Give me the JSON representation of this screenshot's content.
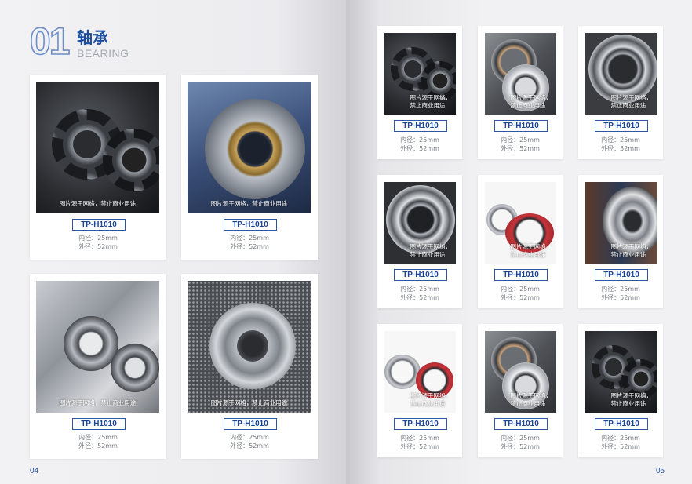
{
  "left_page": {
    "section_number": "01",
    "section_title": "轴承",
    "section_subtitle": "BEARING",
    "page_number": "04"
  },
  "right_page": {
    "page_number": "05"
  },
  "watermark_text": "图片源于网络，禁止商业用途",
  "watermark_line1": "图片源于网络，",
  "watermark_line2": "禁止商业用途",
  "products_left": [
    {
      "model": "TP-H1010",
      "inner": "内径：25mm",
      "outer": "外径：52mm"
    },
    {
      "model": "TP-H1010",
      "inner": "内径：25mm",
      "outer": "外径：52mm"
    },
    {
      "model": "TP-H1010",
      "inner": "内径：25mm",
      "outer": "外径：52mm"
    },
    {
      "model": "TP-H1010",
      "inner": "内径：25mm",
      "outer": "外径：52mm"
    }
  ],
  "products_right": [
    {
      "model": "TP-H1010",
      "inner": "内径：25mm",
      "outer": "外径：52mm"
    },
    {
      "model": "TP-H1010",
      "inner": "内径：25mm",
      "outer": "外径：52mm"
    },
    {
      "model": "TP-H1010",
      "inner": "内径：25mm",
      "outer": "外径：52mm"
    },
    {
      "model": "TP-H1010",
      "inner": "内径：25mm",
      "outer": "外径：52mm"
    },
    {
      "model": "TP-H1010",
      "inner": "内径：25mm",
      "outer": "外径：52mm"
    },
    {
      "model": "TP-H1010",
      "inner": "内径：25mm",
      "outer": "外径：52mm"
    },
    {
      "model": "TP-H1010",
      "inner": "内径：25mm",
      "outer": "外径：52mm"
    },
    {
      "model": "TP-H1010",
      "inner": "内径：25mm",
      "outer": "外径：52mm"
    },
    {
      "model": "TP-H1010",
      "inner": "内径：25mm",
      "outer": "外径：52mm"
    }
  ],
  "colors": {
    "accent": "#1c4fa0",
    "tag_border": "#2c56a3",
    "spec_text": "#777b82"
  }
}
